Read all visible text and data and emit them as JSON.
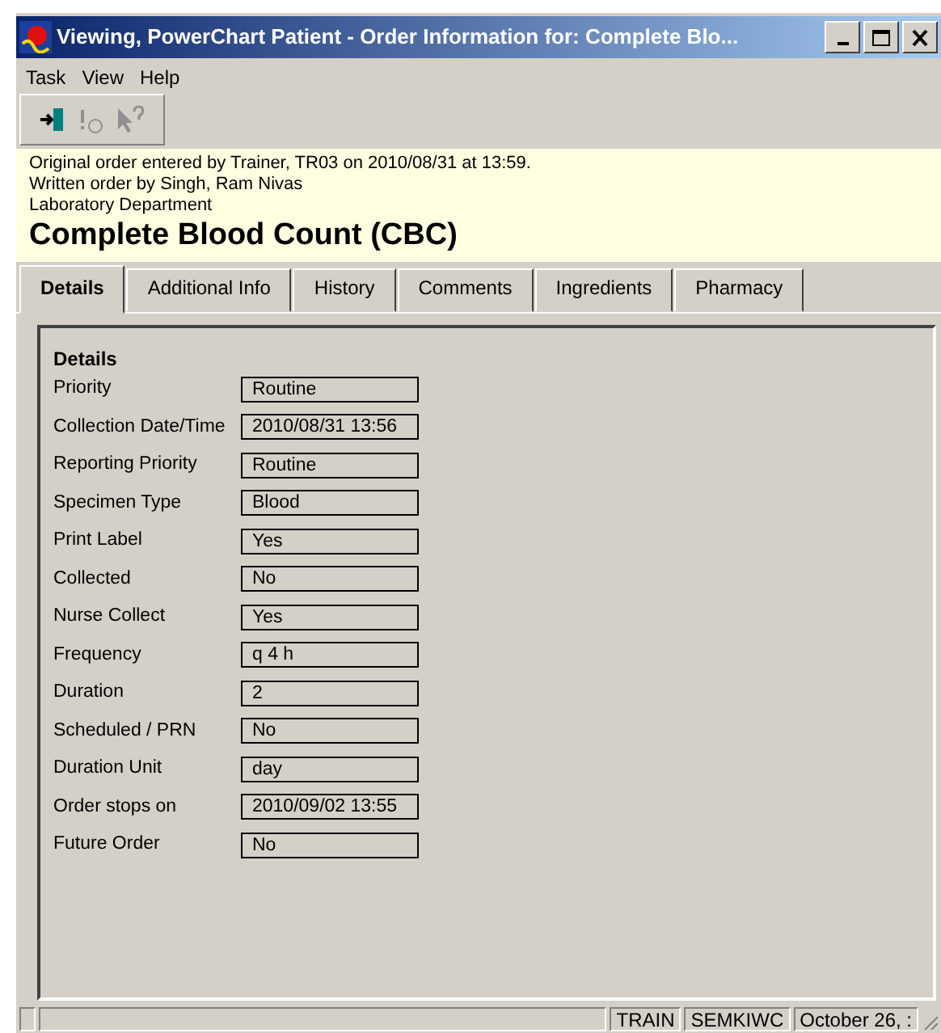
{
  "window": {
    "title": "Viewing, PowerChart Patient - Order Information for:  Complete Blo..."
  },
  "menu": [
    "Task",
    "View",
    "Help"
  ],
  "toolbar": [
    {
      "kind": "exit",
      "disabled": false
    },
    {
      "kind": "alert",
      "disabled": true
    },
    {
      "kind": "help",
      "disabled": true
    }
  ],
  "header": {
    "lines": [
      "Original order entered by Trainer, TR03 on 2010/08/31 at 13:59.",
      "Written order by Singh, Ram Nivas",
      "Laboratory Department"
    ],
    "order_name": "Complete Blood Count (CBC)"
  },
  "tabs": [
    {
      "label": "Details",
      "selected": true
    },
    {
      "label": "Additional Info",
      "selected": false
    },
    {
      "label": "History",
      "selected": false
    },
    {
      "label": "Comments",
      "selected": false
    },
    {
      "label": "Ingredients",
      "selected": false
    },
    {
      "label": "Pharmacy",
      "selected": false
    }
  ],
  "details": {
    "heading": "Details",
    "fields": [
      {
        "label": "Priority",
        "value": "Routine"
      },
      {
        "label": "Collection Date/Time",
        "value": "2010/08/31 13:56"
      },
      {
        "label": "Reporting Priority",
        "value": "Routine"
      },
      {
        "label": "Specimen Type",
        "value": "Blood"
      },
      {
        "label": "Print Label",
        "value": "Yes"
      },
      {
        "label": "Collected",
        "value": "No"
      },
      {
        "label": "Nurse Collect",
        "value": "Yes"
      },
      {
        "label": "Frequency",
        "value": "q 4 h"
      },
      {
        "label": "Duration",
        "value": "2"
      },
      {
        "label": "Scheduled / PRN",
        "value": "No"
      },
      {
        "label": "Duration Unit",
        "value": "day"
      },
      {
        "label": "Order stops on",
        "value": "2010/09/02 13:55"
      },
      {
        "label": "Future Order",
        "value": "No"
      }
    ]
  },
  "status_bar": [
    "TRAIN",
    "SEMKIWC",
    "October 26, :"
  ]
}
